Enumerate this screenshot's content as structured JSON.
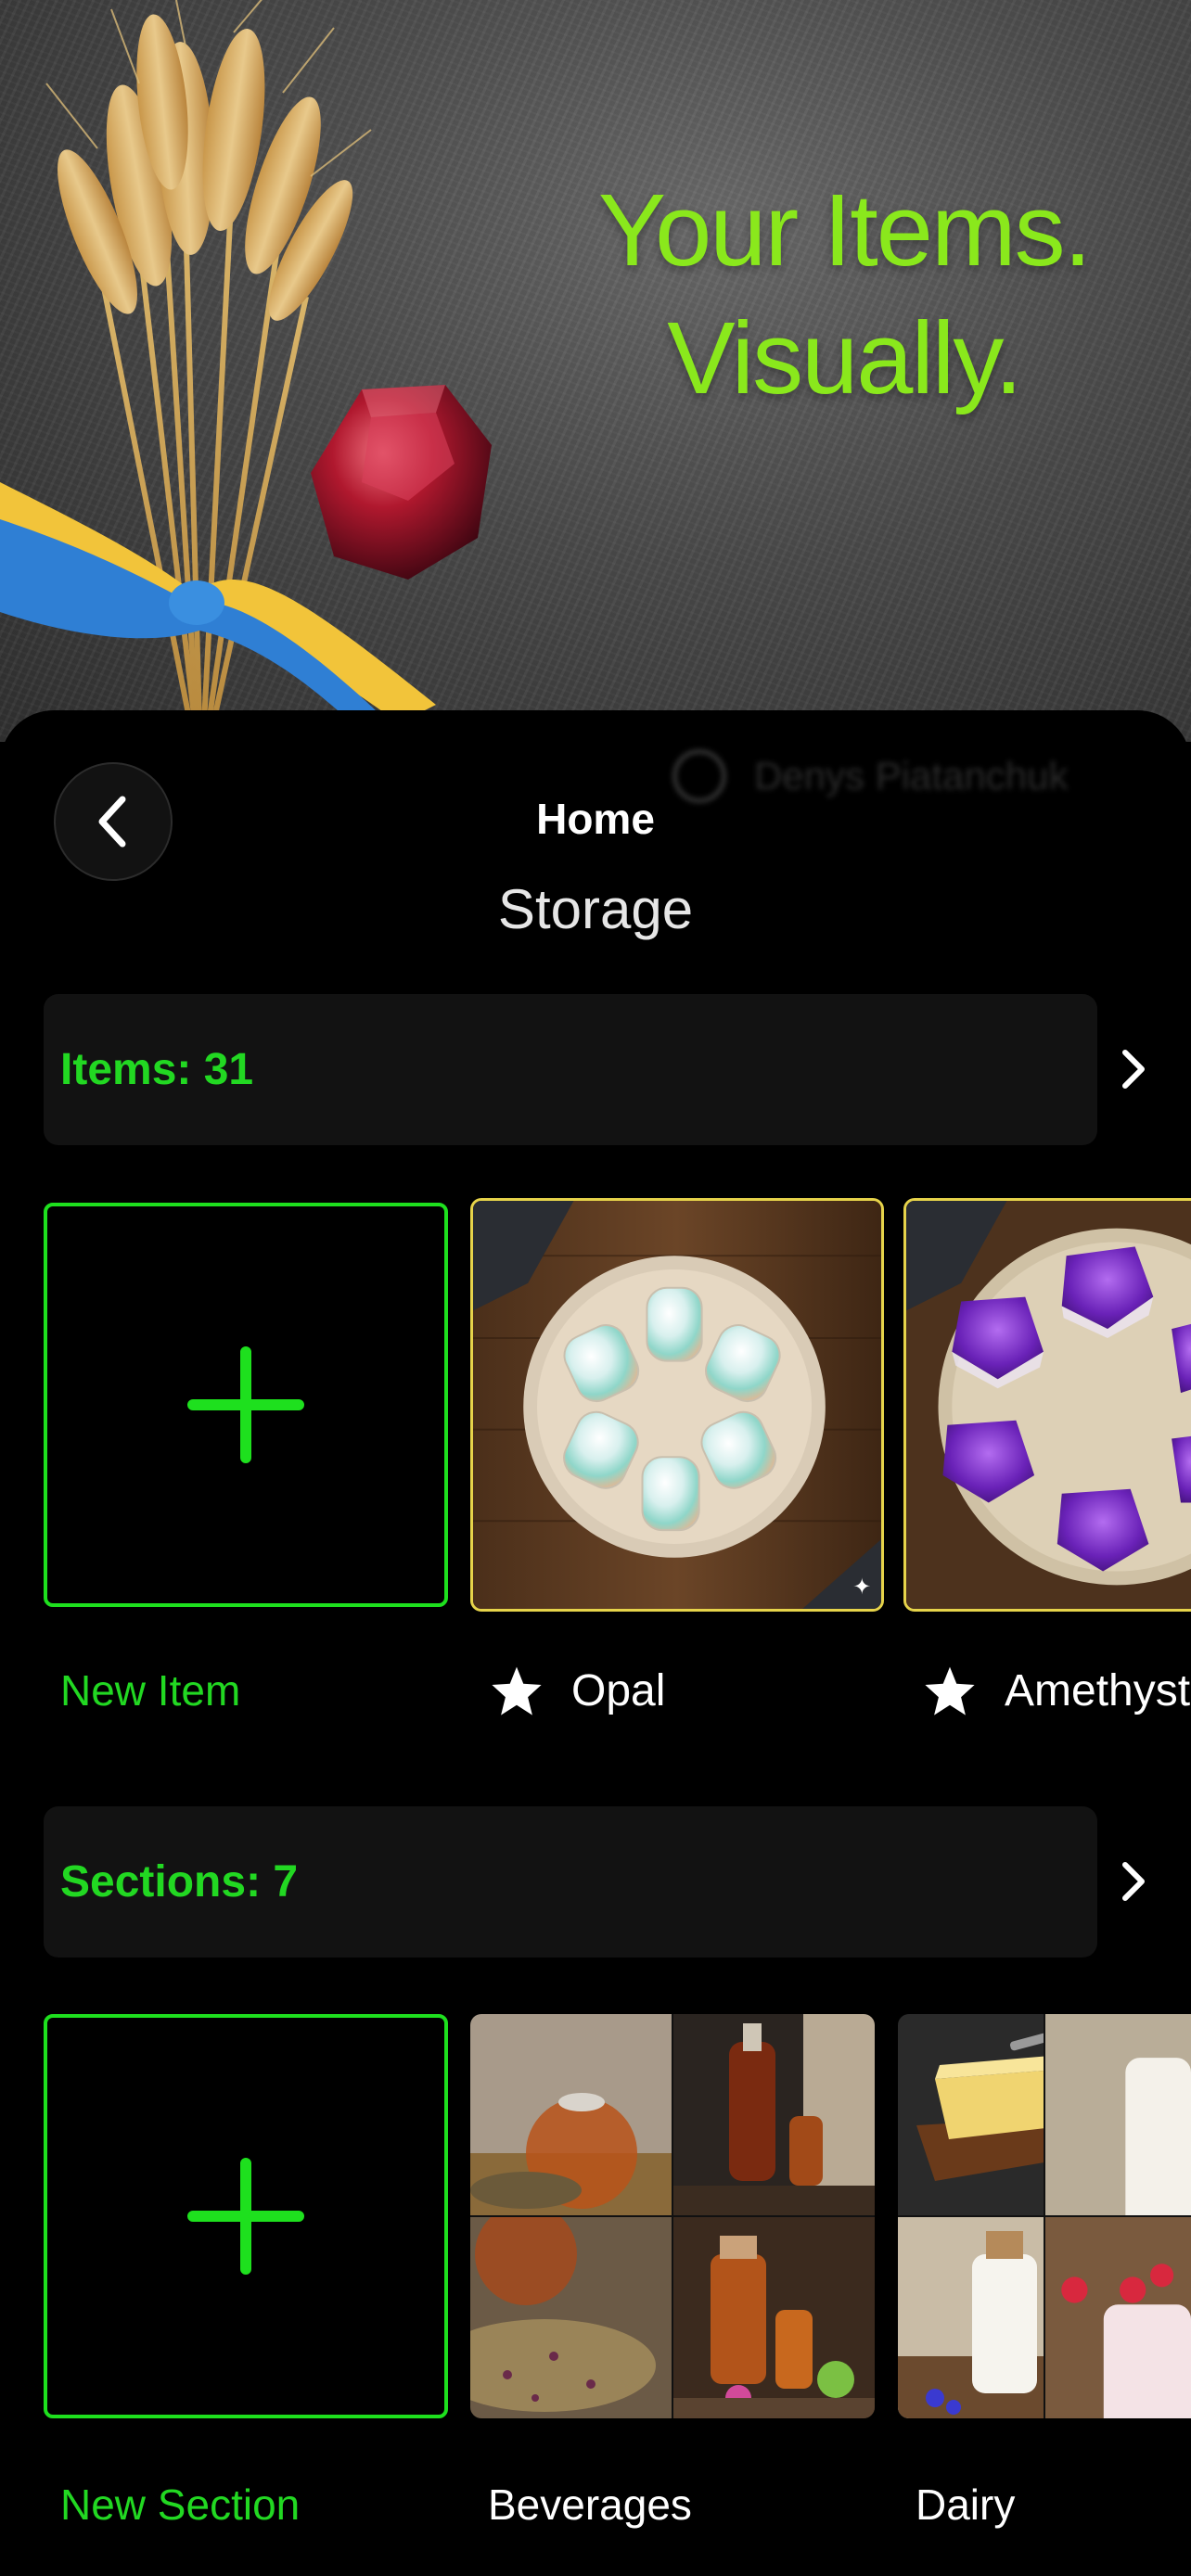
{
  "hero": {
    "line1": "Your Items.",
    "line2": "Visually.",
    "accent_color": "#8ae81c"
  },
  "profile": {
    "name": "Denys Piatanchuk",
    "icon": "user-circle-icon"
  },
  "nav": {
    "back_icon": "chevron-left-icon",
    "title": "Home",
    "subtitle": "Storage"
  },
  "items": {
    "header": "Items: 31",
    "add_label": "New Item",
    "list": [
      {
        "name": "Opal",
        "favorite": true
      },
      {
        "name": "Amethyst",
        "favorite": true
      }
    ]
  },
  "sections": {
    "header": "Sections: 7",
    "add_label": "New Section",
    "list": [
      {
        "name": "Beverages"
      },
      {
        "name": "Dairy"
      }
    ]
  },
  "colors": {
    "accent_green": "#22d822",
    "favorite_border": "#e6d34a",
    "background": "#000000",
    "header_bg": "#121212"
  }
}
